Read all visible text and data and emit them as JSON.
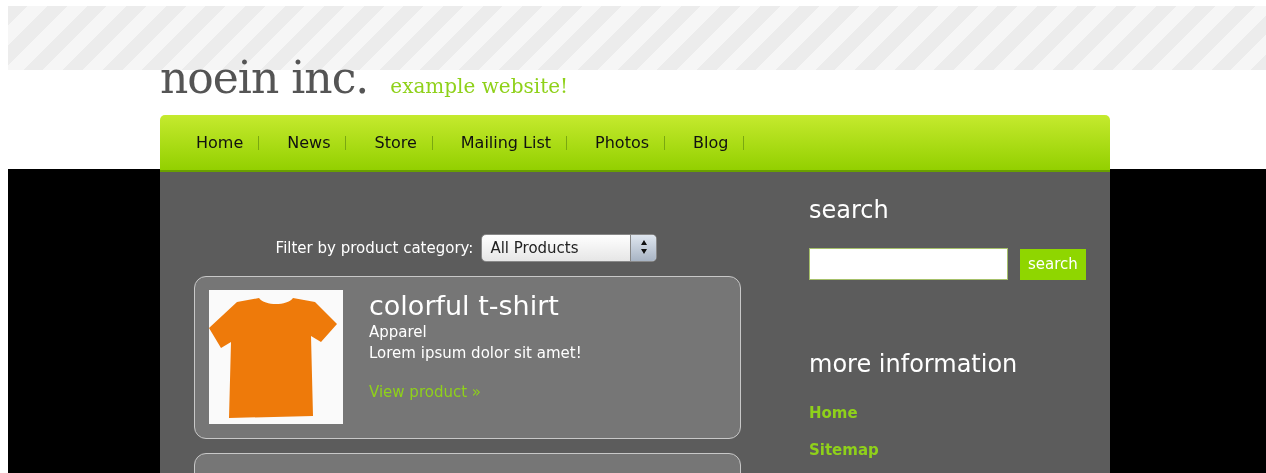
{
  "header": {
    "logo": "noein inc.",
    "tagline": "example website!"
  },
  "nav": [
    {
      "label": "Home"
    },
    {
      "label": "News"
    },
    {
      "label": "Store"
    },
    {
      "label": "Mailing List"
    },
    {
      "label": "Photos"
    },
    {
      "label": "Blog"
    }
  ],
  "filter": {
    "label": "Filter by product category:",
    "value": "All Products"
  },
  "products": [
    {
      "title": "colorful t-shirt",
      "category": "Apparel",
      "description": "Lorem ipsum dolor sit amet!",
      "link": "View product »"
    }
  ],
  "sidebar": {
    "search_title": "search",
    "search_button": "search",
    "info_title": "more information",
    "links": [
      "Home",
      "Sitemap"
    ]
  }
}
